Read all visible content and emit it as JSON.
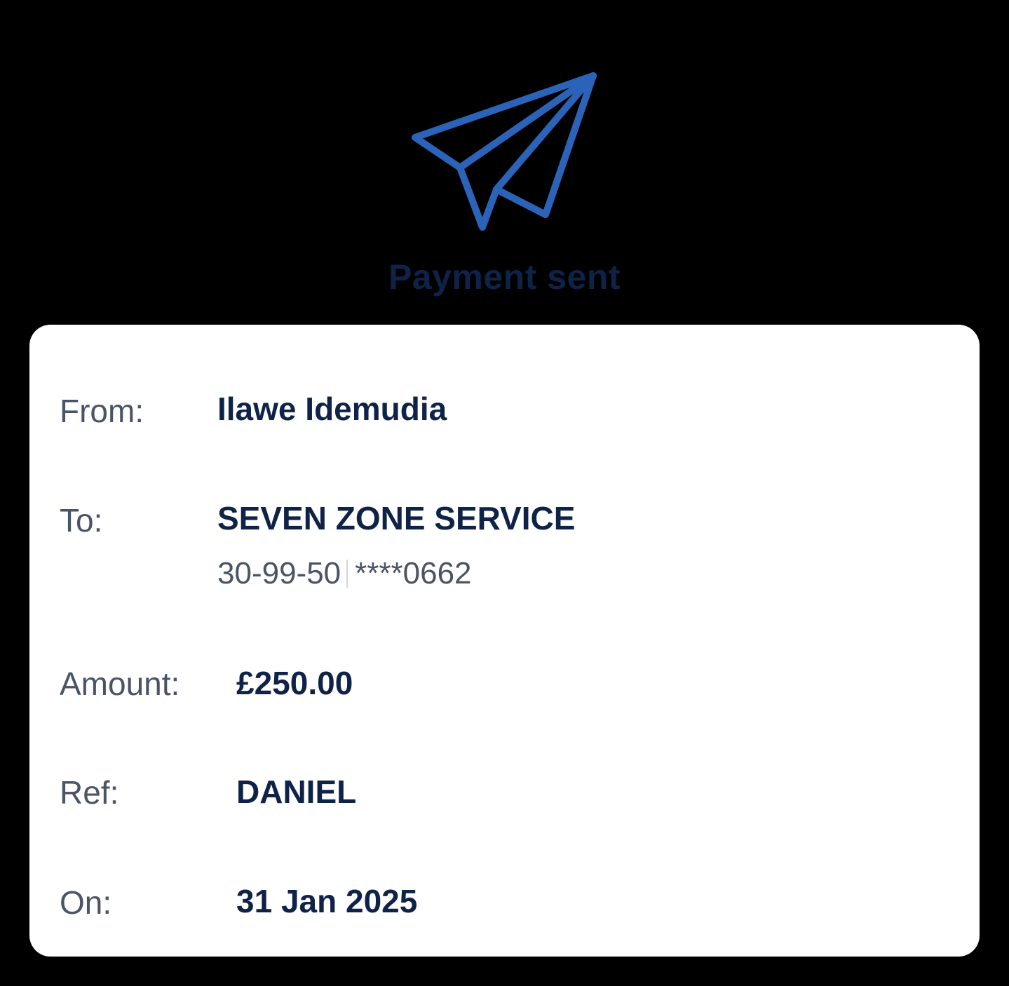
{
  "status": {
    "icon": "paper-plane-icon",
    "title": "Payment sent",
    "icon_color": "#2a63b8",
    "title_color": "#0f2247"
  },
  "details": {
    "from_label": "From:",
    "from_value": "Ilawe Idemudia",
    "to_label": "To:",
    "to_value": "SEVEN ZONE SERVICE",
    "sort_code": "30-99-50",
    "account_number": "****0662",
    "amount_label": "Amount:",
    "amount_value": "£250.00",
    "ref_label": "Ref:",
    "ref_value": "DANIEL",
    "on_label": "On:",
    "on_value": "31 Jan 2025"
  }
}
